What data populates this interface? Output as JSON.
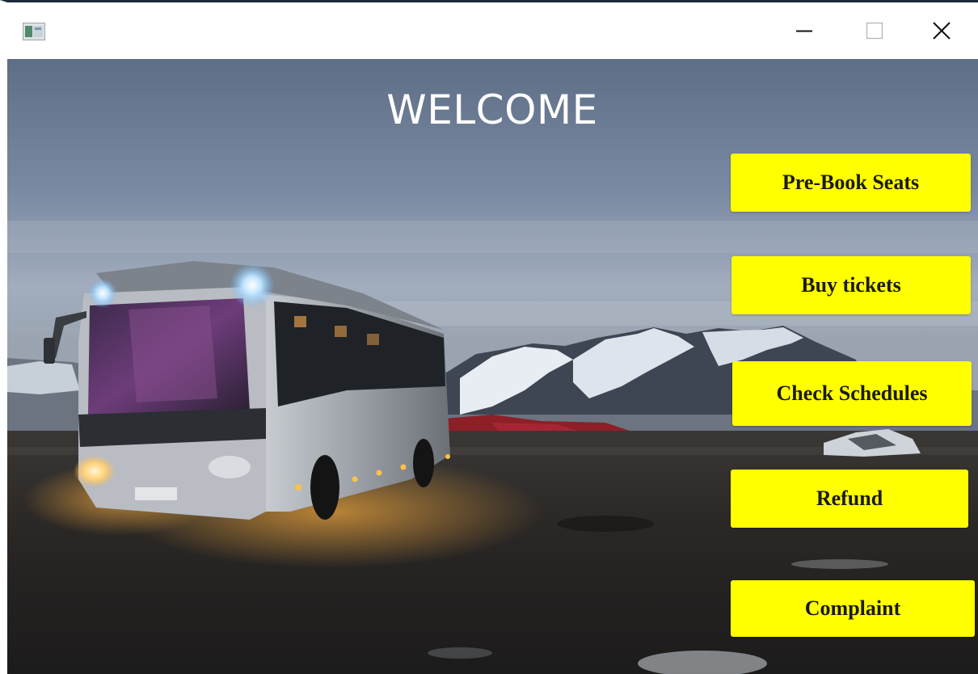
{
  "window": {
    "icons": {
      "app": "app-window-icon",
      "minimize": "minimize-icon",
      "maximize": "maximize-icon",
      "close": "close-icon"
    }
  },
  "main": {
    "heading": "WELCOME",
    "buttons": [
      {
        "label": "Pre-Book Seats"
      },
      {
        "label": "Buy tickets"
      },
      {
        "label": "Check Schedules"
      },
      {
        "label": "Refund"
      },
      {
        "label": "Complaint"
      }
    ]
  },
  "colors": {
    "button_bg": "#ffff00",
    "button_text": "#1a1a1a",
    "heading": "#ffffff",
    "sky": "#6e7f96",
    "ground": "#2a2826"
  }
}
